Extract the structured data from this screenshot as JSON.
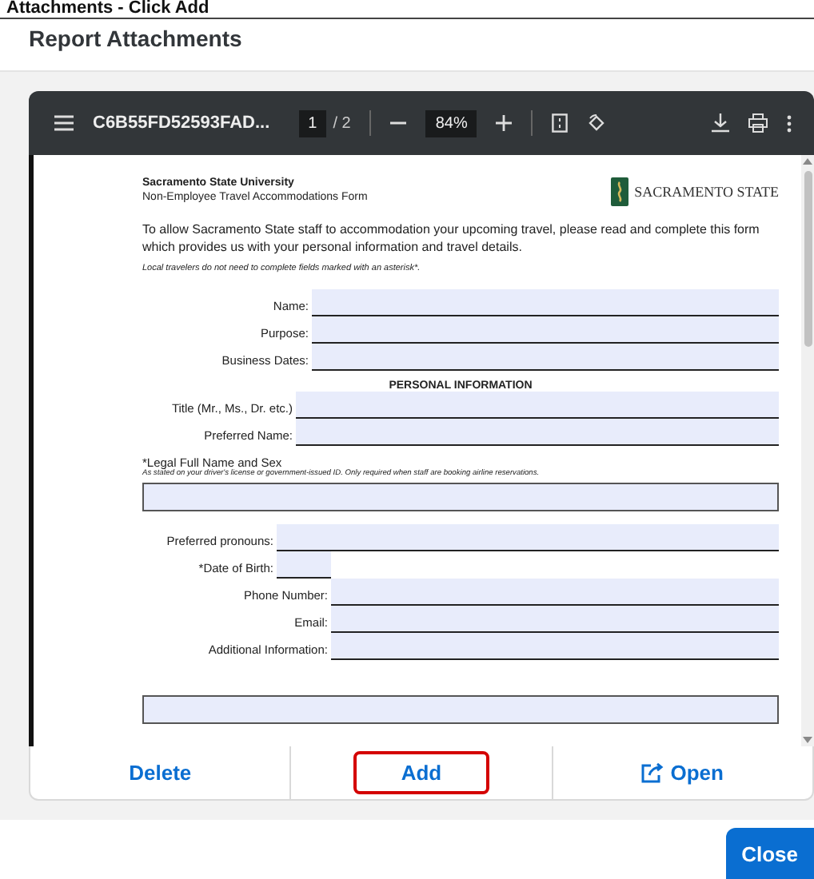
{
  "page_heading": "Attachments - Click Add",
  "dialog": {
    "title": "Report Attachments"
  },
  "viewer": {
    "file_name": "C6B55FD52593FAD...",
    "page": "1",
    "page_total": "/ 2",
    "zoom": "84%"
  },
  "document": {
    "org": "Sacramento State University",
    "form_title": "Non-Employee Travel Accommodations Form",
    "logo_text": "SACRAMENTO STATE",
    "intro": "To allow Sacramento State staff to accommodation your upcoming travel, please read and complete this form which provides us with your personal information and travel details.",
    "note": "Local travelers do not need to complete fields marked with an asterisk*.",
    "top_fields": [
      "Name:",
      "Purpose:",
      "Business Dates:"
    ],
    "section_heading": "PERSONAL INFORMATION",
    "personal_fields": [
      "Title (Mr., Ms., Dr. etc.)",
      "Preferred Name:"
    ],
    "legal_label": "*Legal Full Name and Sex",
    "legal_hint": "As stated on your driver's license or government-issued ID. Only required when staff are booking airline reservations.",
    "pronoun_fields": [
      "Preferred pronouns:",
      "*Date of Birth:"
    ],
    "contact_fields": [
      "Phone Number:",
      "Email:",
      "Additional Information:"
    ]
  },
  "actions": [
    {
      "label": "Delete",
      "kind": "text",
      "highlighted": false
    },
    {
      "label": "Add",
      "kind": "text",
      "highlighted": true
    },
    {
      "label": "Open",
      "kind": "open",
      "highlighted": false
    }
  ],
  "close_button": "Close"
}
